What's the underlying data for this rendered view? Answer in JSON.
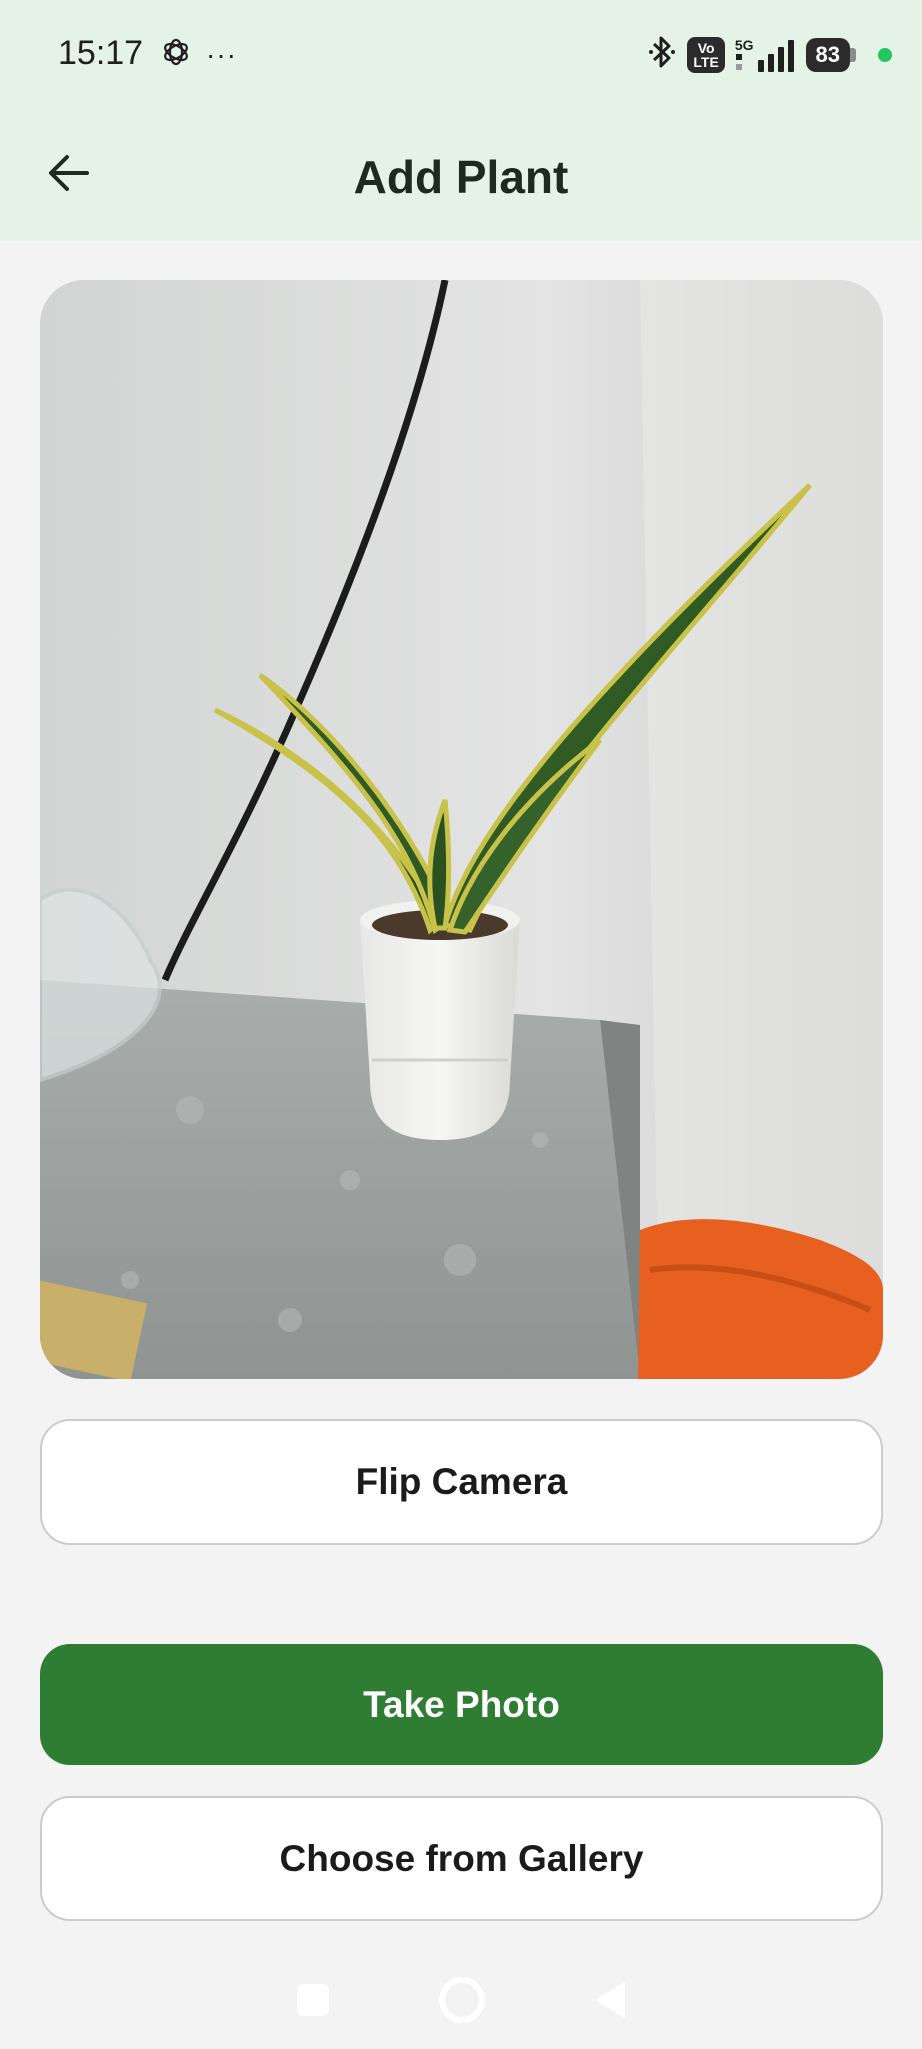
{
  "status_bar": {
    "time": "15:17",
    "more_indicator": "···",
    "volte_badge_line1": "Vo",
    "volte_badge_line2": "LTE",
    "network": "5G",
    "battery_level": "83",
    "icons": [
      "openai-app-icon",
      "bluetooth-icon",
      "volte-icon",
      "signal-icon",
      "battery-icon",
      "privacy-dot-icon"
    ],
    "privacy_dot_color": "#22c55e"
  },
  "header": {
    "title": "Add Plant",
    "back_icon": "arrow-left-icon",
    "background": "#e5f3e6"
  },
  "camera_preview": {
    "subject": "snake plant in white pot on grey table"
  },
  "buttons": {
    "flip_camera": "Flip Camera",
    "take_photo": "Take Photo",
    "choose_gallery": "Choose from Gallery",
    "primary_color": "#2e7d32"
  },
  "navbar": {
    "icons": [
      "recent-apps-icon",
      "home-icon",
      "back-triangle-icon"
    ]
  }
}
